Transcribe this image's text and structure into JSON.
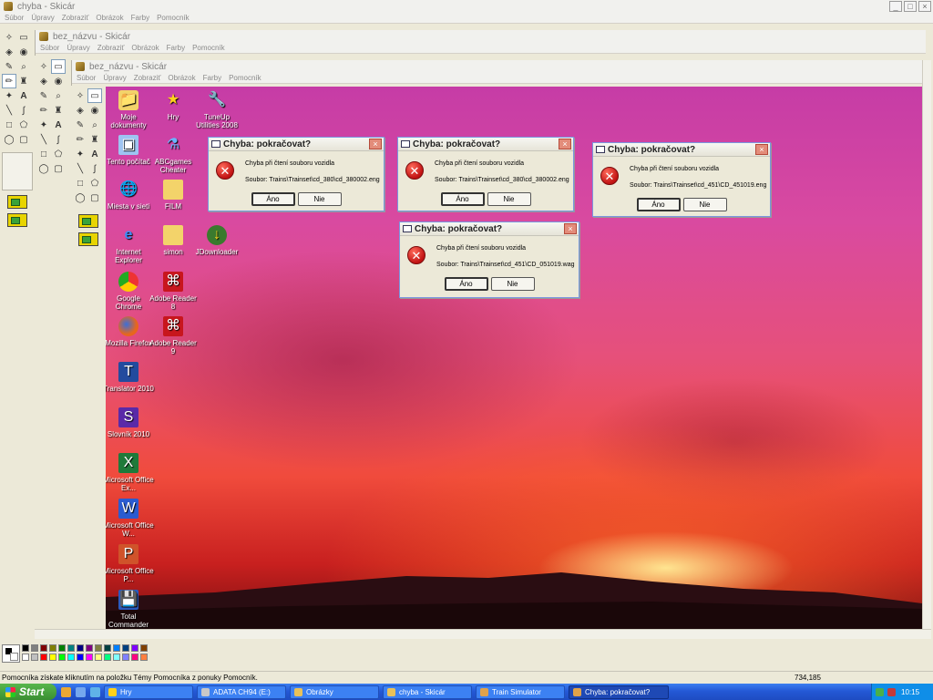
{
  "outer_window": {
    "title": "chyba - Skicár",
    "menu": [
      "Súbor",
      "Úpravy",
      "Zobraziť",
      "Obrázok",
      "Farby",
      "Pomocník"
    ]
  },
  "middle_window": {
    "title": "bez_názvu - Skicár",
    "menu": [
      "Súbor",
      "Úpravy",
      "Zobraziť",
      "Obrázok",
      "Farby",
      "Pomocník"
    ]
  },
  "inner_window": {
    "title": "bez_názvu - Skicár",
    "menu": [
      "Súbor",
      "Úpravy",
      "Zobraziť",
      "Obrázok",
      "Farby",
      "Pomocník"
    ]
  },
  "window_buttons": {
    "minimize": "_",
    "maximize": "□",
    "close": "×"
  },
  "desktop_icons": [
    {
      "label": "Moje dokumenty",
      "icon": "my-documents-icon"
    },
    {
      "label": "Hry",
      "icon": "games-star-icon"
    },
    {
      "label": "TuneUp Utilities 2008",
      "icon": "tuneup-icon"
    },
    {
      "label": "Tento počítač",
      "icon": "my-computer-icon"
    },
    {
      "label": "ABCgames Cheater",
      "icon": "abcgames-icon"
    },
    {
      "label": "Miesta v sieti",
      "icon": "network-places-icon"
    },
    {
      "label": "FILM",
      "icon": "folder-icon"
    },
    {
      "label": "Internet Explorer",
      "icon": "internet-explorer-icon"
    },
    {
      "label": "simon",
      "icon": "folder-icon"
    },
    {
      "label": "JDownloader",
      "icon": "jdownloader-icon"
    },
    {
      "label": "Google Chrome",
      "icon": "google-chrome-icon"
    },
    {
      "label": "Adobe Reader 8",
      "icon": "adobe-reader-icon"
    },
    {
      "label": "Mozilla Firefox",
      "icon": "firefox-icon"
    },
    {
      "label": "Adobe Reader 9",
      "icon": "adobe-reader-icon"
    },
    {
      "label": "Translator 2010",
      "icon": "translator-icon"
    },
    {
      "label": "Slovník 2010",
      "icon": "dictionary-icon"
    },
    {
      "label": "Microsoft Office Ex...",
      "icon": "excel-icon"
    },
    {
      "label": "Microsoft Office W...",
      "icon": "word-icon"
    },
    {
      "label": "Microsoft Office P...",
      "icon": "powerpoint-icon"
    },
    {
      "label": "Total Commander",
      "icon": "total-commander-icon"
    }
  ],
  "dialogs": [
    {
      "title": "Chyba: pokračovat?",
      "message": "Chyba při čtení souboru vozidla",
      "file": "Soubor: Trains\\Trainset\\cd_380\\cd_380002.eng",
      "yes": "Áno",
      "no": "Nie",
      "close": "×"
    },
    {
      "title": "Chyba: pokračovat?",
      "message": "Chyba při čtení souboru vozidla",
      "file": "Soubor: Trains\\Trainset\\cd_380\\cd_380002.eng",
      "yes": "Áno",
      "no": "Nie",
      "close": "×"
    },
    {
      "title": "Chyba: pokračovat?",
      "message": "Chyba při čtení souboru vozidla",
      "file": "Soubor: Trains\\Trainset\\cd_451\\CD_451019.eng",
      "yes": "Áno",
      "no": "Nie",
      "close": "×"
    },
    {
      "title": "Chyba: pokračovat?",
      "message": "Chyba při čtení souboru vozidla",
      "file": "Soubor: Trains\\Trainset\\cd_451\\CD_051019.wag",
      "yes": "Áno",
      "no": "Nie",
      "close": "×"
    }
  ],
  "palette_colors": [
    "#000000",
    "#808080",
    "#800000",
    "#808000",
    "#008000",
    "#008080",
    "#000080",
    "#800080",
    "#808040",
    "#004040",
    "#0080ff",
    "#004080",
    "#8000ff",
    "#804000",
    "#ffffff",
    "#c0c0c0",
    "#ff0000",
    "#ffff00",
    "#00ff00",
    "#00ffff",
    "#0000ff",
    "#ff00ff",
    "#ffff80",
    "#00ff80",
    "#80ffff",
    "#8080ff",
    "#ff0080",
    "#ff8040"
  ],
  "status": {
    "help_text": "Pomocníka získate kliknutím na položku Témy Pomocníka z ponuky Pomocník.",
    "coords": "734,185"
  },
  "taskbar": {
    "start": "Start",
    "items": [
      {
        "label": "Hry",
        "active": false
      },
      {
        "label": "ADATA CH94 (E:)",
        "active": false
      },
      {
        "label": "Obrázky",
        "active": false
      },
      {
        "label": "chyba - Skicár",
        "active": false
      },
      {
        "label": "Train Simulator",
        "active": false
      },
      {
        "label": "Chyba: pokračovat?",
        "active": true
      }
    ],
    "clock": "10:15"
  }
}
